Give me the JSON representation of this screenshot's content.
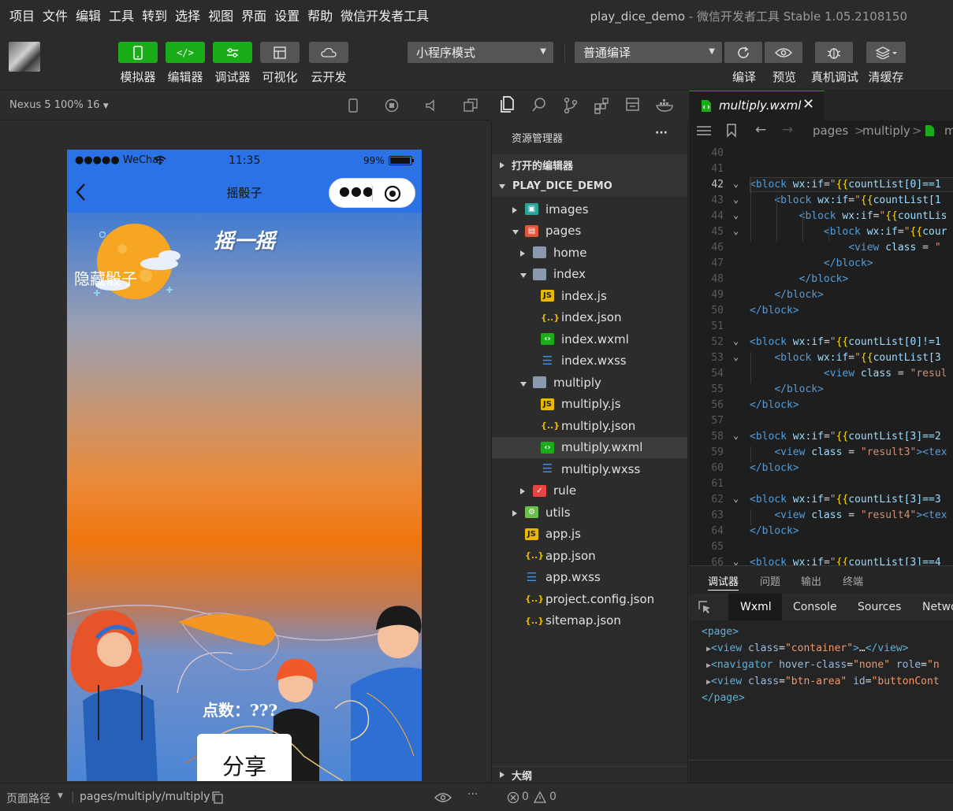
{
  "menu": [
    "项目",
    "文件",
    "编辑",
    "工具",
    "转到",
    "选择",
    "视图",
    "界面",
    "设置",
    "帮助",
    "微信开发者工具"
  ],
  "window_title": {
    "project": "play_dice_demo",
    "app": "微信开发者工具 Stable 1.05.2108150"
  },
  "toolbar": {
    "simulator": "模拟器",
    "editor": "编辑器",
    "debugger": "调试器",
    "visual": "可视化",
    "cloud": "云开发",
    "mode_select": "小程序模式",
    "compile_select": "普通编译",
    "compile": "编译",
    "preview": "预览",
    "real_debug": "真机调试",
    "clear_cache": "清缓存"
  },
  "simulator": {
    "device": "Nexus 5 100% 16",
    "status": {
      "carrier": "●●●●● WeChat",
      "time": "11:35",
      "battery": "99%"
    },
    "nav_title": "摇骰子",
    "page": {
      "shake_title": "摇一摇",
      "hide_dice": "隐藏骰子",
      "points": "点数：???",
      "share": "分享"
    }
  },
  "explorer": {
    "title": "资源管理器",
    "more": "···",
    "open_editors": "打开的编辑器",
    "project": "PLAY_DICE_DEMO",
    "outline": "大纲",
    "tree": [
      {
        "label": "images",
        "type": "folder-img",
        "depth": 1,
        "arrow": "right"
      },
      {
        "label": "pages",
        "type": "folder-pages",
        "depth": 1,
        "arrow": "down"
      },
      {
        "label": "home",
        "type": "folder",
        "depth": 2,
        "arrow": "right"
      },
      {
        "label": "index",
        "type": "folder-open",
        "depth": 2,
        "arrow": "down"
      },
      {
        "label": "index.js",
        "type": "js",
        "depth": 3
      },
      {
        "label": "index.json",
        "type": "json",
        "depth": 3
      },
      {
        "label": "index.wxml",
        "type": "wxml",
        "depth": 3
      },
      {
        "label": "index.wxss",
        "type": "wxss",
        "depth": 3
      },
      {
        "label": "multiply",
        "type": "folder-open",
        "depth": 2,
        "arrow": "down"
      },
      {
        "label": "multiply.js",
        "type": "js",
        "depth": 3
      },
      {
        "label": "multiply.json",
        "type": "json",
        "depth": 3
      },
      {
        "label": "multiply.wxml",
        "type": "wxml",
        "depth": 3,
        "selected": true
      },
      {
        "label": "multiply.wxss",
        "type": "wxss",
        "depth": 3
      },
      {
        "label": "rule",
        "type": "folder-rule",
        "depth": 2,
        "arrow": "right"
      },
      {
        "label": "utils",
        "type": "folder-utils",
        "depth": 1,
        "arrow": "right"
      },
      {
        "label": "app.js",
        "type": "js",
        "depth": 1
      },
      {
        "label": "app.json",
        "type": "json",
        "depth": 1
      },
      {
        "label": "app.wxss",
        "type": "wxss",
        "depth": 1
      },
      {
        "label": "project.config.json",
        "type": "json",
        "depth": 1
      },
      {
        "label": "sitemap.json",
        "type": "json",
        "depth": 1
      }
    ]
  },
  "editor": {
    "tab": "multiply.wxml",
    "breadcrumb": [
      "pages",
      "multiply",
      "m"
    ],
    "current_line": 42,
    "lines": [
      {
        "n": 40,
        "html": ""
      },
      {
        "n": 41,
        "html": ""
      },
      {
        "n": 42,
        "fold": true,
        "html": "<span class='k'>&lt;block</span> <span class='a'>wx:if</span>=<span class='s'>\"</span><span class='y'>{{</span><span class='a'>countList[0]==1</span>"
      },
      {
        "n": 43,
        "fold": true,
        "html": "    <span class='k'>&lt;block</span> <span class='a'>wx:if</span>=<span class='s'>\"</span><span class='y'>{{</span><span class='a'>countList[1</span>"
      },
      {
        "n": 44,
        "fold": true,
        "html": "        <span class='k'>&lt;block</span> <span class='a'>wx:if</span>=<span class='s'>\"</span><span class='y'>{{</span><span class='a'>countLis</span>"
      },
      {
        "n": 45,
        "fold": true,
        "html": "            <span class='k'>&lt;block</span> <span class='a'>wx:if</span>=<span class='s'>\"</span><span class='y'>{{</span><span class='a'>cour</span>"
      },
      {
        "n": 46,
        "html": "                <span class='k'>&lt;view</span> <span class='a'>class</span> = <span class='s'>\"</span>"
      },
      {
        "n": 47,
        "html": "            <span class='k'>&lt;/block&gt;</span>"
      },
      {
        "n": 48,
        "html": "        <span class='k'>&lt;/block&gt;</span>"
      },
      {
        "n": 49,
        "html": "    <span class='k'>&lt;/block&gt;</span>"
      },
      {
        "n": 50,
        "html": "<span class='k'>&lt;/block&gt;</span>"
      },
      {
        "n": 51,
        "html": ""
      },
      {
        "n": 52,
        "fold": true,
        "html": "<span class='k'>&lt;block</span> <span class='a'>wx:if</span>=<span class='s'>\"</span><span class='y'>{{</span><span class='a'>countList[0]!=1</span>"
      },
      {
        "n": 53,
        "fold": true,
        "html": "    <span class='k'>&lt;block</span> <span class='a'>wx:if</span>=<span class='s'>\"</span><span class='y'>{{</span><span class='a'>countList[3</span>"
      },
      {
        "n": 54,
        "html": "            <span class='k'>&lt;view</span> <span class='a'>class</span> = <span class='s'>\"resul</span>"
      },
      {
        "n": 55,
        "html": "    <span class='k'>&lt;/block&gt;</span>"
      },
      {
        "n": 56,
        "html": "<span class='k'>&lt;/block&gt;</span>"
      },
      {
        "n": 57,
        "html": ""
      },
      {
        "n": 58,
        "fold": true,
        "html": "<span class='k'>&lt;block</span> <span class='a'>wx:if</span>=<span class='s'>\"</span><span class='y'>{{</span><span class='a'>countList[3]==2</span>"
      },
      {
        "n": 59,
        "html": "    <span class='k'>&lt;view</span> <span class='a'>class</span> = <span class='s'>\"result3\"</span><span class='k'>&gt;&lt;tex</span>"
      },
      {
        "n": 60,
        "html": "<span class='k'>&lt;/block&gt;</span>"
      },
      {
        "n": 61,
        "html": ""
      },
      {
        "n": 62,
        "fold": true,
        "html": "<span class='k'>&lt;block</span> <span class='a'>wx:if</span>=<span class='s'>\"</span><span class='y'>{{</span><span class='a'>countList[3]==3</span>"
      },
      {
        "n": 63,
        "html": "    <span class='k'>&lt;view</span> <span class='a'>class</span> = <span class='s'>\"result4\"</span><span class='k'>&gt;&lt;tex</span>"
      },
      {
        "n": 64,
        "html": "<span class='k'>&lt;/block&gt;</span>"
      },
      {
        "n": 65,
        "html": ""
      },
      {
        "n": 66,
        "fold": true,
        "html": "<span class='k'>&lt;block</span> <span class='a'>wx:if</span>=<span class='s'>\"</span><span class='y'>{{</span><span class='a'>countList[3]==4</span>"
      }
    ]
  },
  "debugger": {
    "tabs": [
      "调试器",
      "问题",
      "输出",
      "终端"
    ],
    "subtabs": [
      "Wxml",
      "Console",
      "Sources",
      "Netwo"
    ],
    "dom": [
      {
        "indent": 0,
        "arrow": false,
        "html": "<span class='tg'>&lt;page&gt;</span>"
      },
      {
        "indent": 1,
        "arrow": true,
        "html": "<span class='tg'>&lt;view</span> <span class='at'>class</span>=<span class='av'>\"container\"</span><span class='tg'>&gt;</span>…<span class='tg'>&lt;/view&gt;</span>"
      },
      {
        "indent": 1,
        "arrow": true,
        "html": "<span class='tg'>&lt;navigator</span> <span class='at'>hover-class</span>=<span class='av'>\"none\"</span> <span class='at'>role</span>=<span class='av'>\"n</span>"
      },
      {
        "indent": 1,
        "arrow": true,
        "html": "<span class='tg'>&lt;view</span> <span class='at'>class</span>=<span class='av'>\"btn-area\"</span> <span class='at'>id</span>=<span class='av'>\"buttonCont</span>"
      },
      {
        "indent": 0,
        "arrow": false,
        "html": "<span class='tg'>&lt;/page&gt;</span>"
      }
    ]
  },
  "bottom": {
    "page_path_label": "页面路径",
    "page_path": "pages/multiply/multiply",
    "errors": "0",
    "warnings": "0"
  }
}
